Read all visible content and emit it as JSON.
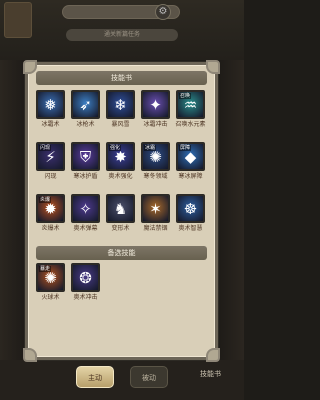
{
  "background": {
    "task_text": "通关新篇任务",
    "bottom_label": "技能书"
  },
  "panel": {
    "title": "技能书",
    "equipped_title": "备选技能"
  },
  "skills": [
    {
      "name": "冰霜术",
      "color": "#3b6fb3",
      "icon": "ice-shard-icon",
      "glyph": "❅",
      "tag": ""
    },
    {
      "name": "冰枪术",
      "color": "#3d7fc4",
      "icon": "ice-lance-icon",
      "glyph": "➶",
      "tag": ""
    },
    {
      "name": "暴风雪",
      "color": "#2f4f9a",
      "icon": "blizzard-icon",
      "glyph": "❄",
      "tag": ""
    },
    {
      "name": "冰霜冲击",
      "color": "#6a4fb0",
      "icon": "frost-shock-icon",
      "glyph": "✦",
      "tag": ""
    },
    {
      "name": "召唤水元素",
      "color": "#2b8e8c",
      "icon": "water-elemental-icon",
      "glyph": "♒",
      "tag": "召唤"
    },
    {
      "name": "闪现",
      "color": "#3b2f6e",
      "icon": "blink-icon",
      "glyph": "⚡",
      "tag": "闪现"
    },
    {
      "name": "寒冰护盾",
      "color": "#5a3c9e",
      "icon": "ice-shield-icon",
      "glyph": "⛨",
      "tag": ""
    },
    {
      "name": "奥术强化",
      "color": "#3c3f9a",
      "icon": "arcane-empower-icon",
      "glyph": "✸",
      "tag": "强化"
    },
    {
      "name": "寒冬领域",
      "color": "#2d4d86",
      "icon": "winter-domain-icon",
      "glyph": "✺",
      "tag": "冰霜"
    },
    {
      "name": "寒冰屏障",
      "color": "#2e6fb8",
      "icon": "ice-barrier-icon",
      "glyph": "◆",
      "tag": "屏障"
    },
    {
      "name": "炎爆术",
      "color": "#b8501e",
      "icon": "pyroblast-icon",
      "glyph": "✹",
      "tag": "炎爆"
    },
    {
      "name": "奥术弹幕",
      "color": "#4e3a8e",
      "icon": "arcane-barrage-icon",
      "glyph": "✧",
      "tag": ""
    },
    {
      "name": "变形术",
      "color": "#4b4f6a",
      "icon": "polymorph-icon",
      "glyph": "♞",
      "tag": ""
    },
    {
      "name": "魔法禁锢",
      "color": "#a8692a",
      "icon": "magic-bind-icon",
      "glyph": "✶",
      "tag": ""
    },
    {
      "name": "奥术智慧",
      "color": "#2d5fa0",
      "icon": "arcane-wisdom-icon",
      "glyph": "☸",
      "tag": ""
    }
  ],
  "equipped": [
    {
      "name": "火球术",
      "color": "#b2521e",
      "icon": "fireball-icon",
      "glyph": "✺",
      "tag": "暴走"
    },
    {
      "name": "奥术冲击",
      "color": "#4a3b88",
      "icon": "arcane-blast-icon",
      "glyph": "❂",
      "tag": ""
    }
  ],
  "tabs": {
    "active": "主动",
    "inactive": "被动"
  }
}
